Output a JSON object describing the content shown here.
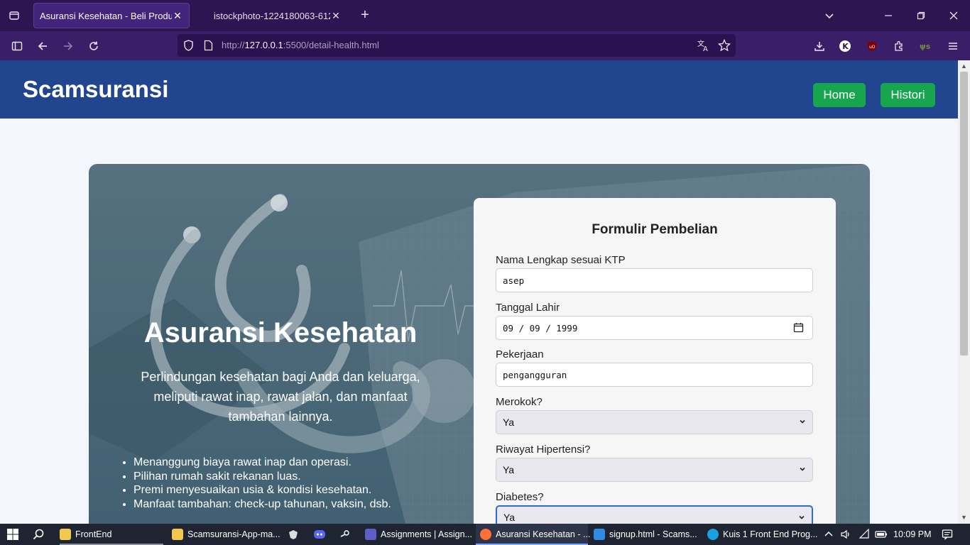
{
  "browser": {
    "tabs": [
      {
        "title": "Asuransi Kesehatan - Beli Produk",
        "active": true
      },
      {
        "title": "istockphoto-1224180063-612x6",
        "active": false
      }
    ],
    "url": {
      "prefix": "http://",
      "host": "127.0.0.1",
      "rest": ":5500/detail-health.html"
    }
  },
  "site": {
    "brand": "Scamsuransi",
    "nav": [
      {
        "label": "Home"
      },
      {
        "label": "Histori"
      }
    ]
  },
  "hero": {
    "title": "Asuransi Kesehatan",
    "description": "Perlindungan kesehatan bagi Anda dan keluarga, meliputi rawat inap, rawat jalan, dan manfaat tambahan lainnya.",
    "benefits": [
      "Menanggung biaya rawat inap dan operasi.",
      "Pilihan rumah sakit rekanan luas.",
      "Premi menyesuaikan usia & kondisi kesehatan.",
      "Manfaat tambahan: check-up tahunan, vaksin, dsb."
    ]
  },
  "form": {
    "title": "Formulir Pembelian",
    "fields": [
      {
        "label": "Nama Lengkap sesuai KTP",
        "value": "asep",
        "type": "text"
      },
      {
        "label": "Tanggal Lahir",
        "value": "09 / 09 / 1999",
        "type": "date"
      },
      {
        "label": "Pekerjaan",
        "value": "pengangguran",
        "type": "text"
      },
      {
        "label": "Merokok?",
        "value": "Ya",
        "type": "select"
      },
      {
        "label": "Riwayat Hipertensi?",
        "value": "Ya",
        "type": "select"
      },
      {
        "label": "Diabetes?",
        "value": "Ya",
        "type": "select"
      }
    ]
  },
  "taskbar": {
    "items": [
      {
        "label": "FrontEnd",
        "color": "#f2c94c"
      },
      {
        "label": "Scamsuransi-App-ma...",
        "color": "#f2c94c"
      },
      {
        "label": "Assignments | Assign...",
        "color": "#5b5fc7"
      },
      {
        "label": "Asuransi Kesehatan - ...",
        "color": "#ff7139"
      },
      {
        "label": "signup.html - Scams...",
        "color": "#2f8ce0"
      },
      {
        "label": "Kuis 1 Front End Prog...",
        "color": "#1ba0e2"
      }
    ],
    "clock": "10:09 PM"
  },
  "colors": {
    "header": "#21468f",
    "nav_button": "#17a64e",
    "tabbar": "#2d1552"
  }
}
